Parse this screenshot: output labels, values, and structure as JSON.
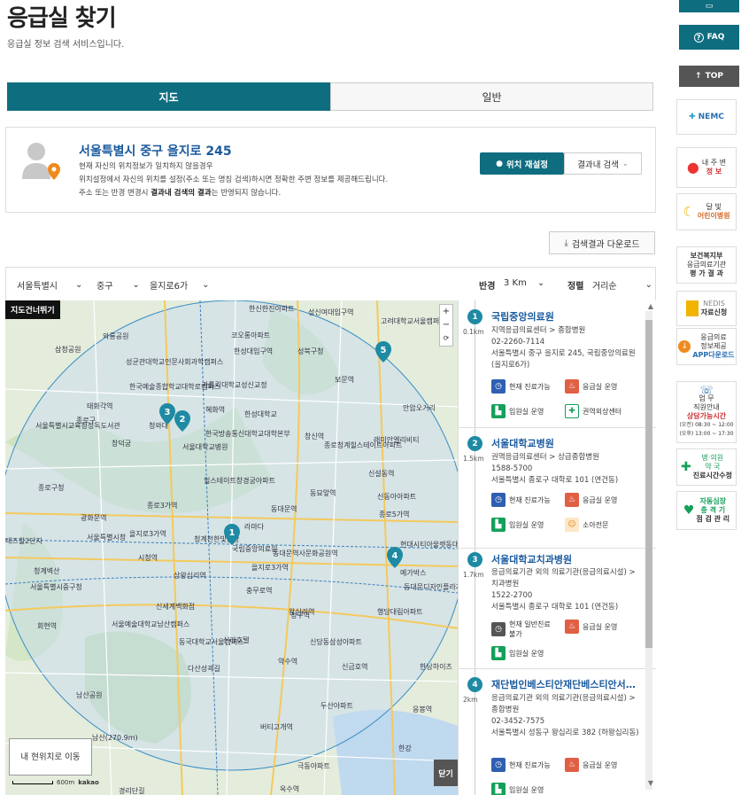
{
  "page": {
    "title": "응급실 찾기",
    "subtitle": "응급실 정보 검색 서비스입니다."
  },
  "tabs": [
    {
      "label": "지도",
      "active": true
    },
    {
      "label": "일반",
      "active": false
    }
  ],
  "location": {
    "address": "서울특별시 중구 을지로 245",
    "line1": "현재 자신의 위치정보가 일치하지 않을경우",
    "line2": "위치설정에서 자신의 위치를 설정(주소 또는 명칭 검색)하시면 정확한 주변 정보를 제공해드립니다.",
    "line3_a": "주소 또는 반경 변경시 ",
    "line3_b": "결과내 검색의 결과",
    "line3_c": "는 반영되지 않습니다.",
    "reset_label": "위치 재설정",
    "search_in_results_label": "결과내 검색"
  },
  "download_label": "검색결과 다운로드",
  "filters": {
    "sido": "서울특별시",
    "gu": "중구",
    "dong": "을지로6가",
    "radius_label": "반경",
    "radius_value": "3 Km",
    "sort_label": "정렬",
    "sort_value": "거리순"
  },
  "map": {
    "skip_label": "지도건너뛰기",
    "my_location_label": "내 현위치로 이동",
    "close_label": "닫기",
    "scale_label": "600m",
    "brand": "kakao",
    "labels": [
      "한신한진아파트",
      "성신여대입구역",
      "고려대학교서울캠퍼스",
      "와룡공원",
      "코오롱아파트",
      "삼청공원",
      "성북구청",
      "성균관대학교인문사회과학캠퍼스",
      "한성대입구역",
      "한국예술종합학교대학로캠퍼스",
      "가톨릭대학교성신교정",
      "보문역",
      "태화각역",
      "혜화역",
      "한성대학교",
      "종로구",
      "안암오거리",
      "서울특별시교육청정독도서관",
      "서울대학교병원",
      "한국방송통신대학교대학본부",
      "창신역",
      "종로청계힐스테이트아파트",
      "래미안엘리비티",
      "청와대",
      "창덕궁",
      "힐스테이트창경궁아파트",
      "신설동역",
      "종로구청",
      "동묘앞역",
      "종로3가역",
      "동대문역",
      "신동아아파트",
      "광화문역",
      "을지로3가역",
      "종로5가역",
      "테즈힐2단지",
      "서울특별시청",
      "청계천한빛광장",
      "라마다",
      "현대시티아울렛동대문점",
      "청계벽산",
      "시청역",
      "을지로3가역",
      "동대문역사문화공원역",
      "메가박스",
      "상왕십리역",
      "서울특별시중구청",
      "국립중앙의료원",
      "신세계백화점",
      "충무로역",
      "동대문디자인플라자",
      "왕십리역",
      "서울예술대학교남산캠퍼스",
      "청구역",
      "동국대학교서울캠퍼스",
      "신당동삼성아파트",
      "행당대림아파트",
      "회현역",
      "신라호텔",
      "약수역",
      "다산성곽길",
      "신금호역",
      "남산공원",
      "버티고개역",
      "한남하이츠",
      "두산아파트",
      "응봉역",
      "남산(270.9m)",
      "극동아파트",
      "한강",
      "옥수역",
      "경리단길"
    ]
  },
  "results": [
    {
      "num": "1",
      "dist": "0.1km",
      "name": "국립중앙의료원",
      "type": "지역응급의료센터 > 종합병원",
      "phone": "02-2260-7114",
      "address": "서울특별시 중구 을지로 245, 국립중앙의료원 (을지로6가)",
      "badges": [
        {
          "icon": "b",
          "text": "현재 진료가능"
        },
        {
          "icon": "r",
          "text": "응급실 운영"
        },
        {
          "icon": "g",
          "text": "입원실 운영"
        },
        {
          "icon": "g",
          "text": "권역외상센터"
        }
      ]
    },
    {
      "num": "2",
      "dist": "1.5km",
      "name": "서울대학교병원",
      "type": "권역응급의료센터 > 상급종합병원",
      "phone": "1588-5700",
      "address": "서울특별시 종로구 대학로 101 (연건동)",
      "badges": [
        {
          "icon": "b",
          "text": "현재 진료가능"
        },
        {
          "icon": "r",
          "text": "응급실 운영"
        },
        {
          "icon": "g",
          "text": "입원실 운영"
        },
        {
          "icon": "c",
          "text": "소아전문"
        }
      ]
    },
    {
      "num": "3",
      "dist": "1.7km",
      "name": "서울대학교치과병원",
      "type": "응급의료기관 외의 의료기관(응급의료시설) > 치과병원",
      "phone": "1522-2700",
      "address": "서울특별시 종로구 대학로 101 (연건동)",
      "badges": [
        {
          "icon": "gr",
          "text": "현재 일반진료불가"
        },
        {
          "icon": "r",
          "text": "응급실 운영"
        },
        {
          "icon": "g",
          "text": "입원실 운영"
        }
      ]
    },
    {
      "num": "4",
      "dist": "2km",
      "name": "재단법인베스티안재단베스티안서울병원",
      "type": "응급의료기관 외의 의료기관(응급의료시설) > 종합병원",
      "phone": "02-3452-7575",
      "address": "서울특별시 성동구 왕십리로 382 (하왕십리동)",
      "badges": [
        {
          "icon": "b",
          "text": "현재 진료가능"
        },
        {
          "icon": "r",
          "text": "응급실 운영"
        },
        {
          "icon": "g",
          "text": "입원실 운영"
        }
      ]
    }
  ],
  "side": {
    "faq": "FAQ",
    "top": "TOP",
    "nemc": "NEMC",
    "nearby_1": "내 주 변",
    "nearby_2": "정 보",
    "moon_1": "달  빛",
    "moon_2": "어린이병원",
    "mohw_1": "보건복지부",
    "mohw_2": "응급의료기관",
    "mohw_3": "평 가 결 과",
    "nedis_1": "NEDIS",
    "nedis_2": "자료신청",
    "app_1": "응급의료",
    "app_2": "정보제공",
    "app_3": "APP다운로드",
    "call_1": "업  무",
    "call_2": "직원안내",
    "call_3": "상담가능시간",
    "call_4": "(오전) 08:30 ~ 12:00",
    "call_5": "(오후) 13:00 ~ 17:30",
    "hosp_1": "병·의원",
    "hosp_2": "약    국",
    "hosp_3": "진료시간수정",
    "aed_1": "자동심장",
    "aed_2": "충 격 기",
    "aed_3": "점 검 관 리"
  },
  "colors": {
    "primary": "#0f6d80",
    "link": "#1a5a9e",
    "marker": "#1f8aa3"
  }
}
